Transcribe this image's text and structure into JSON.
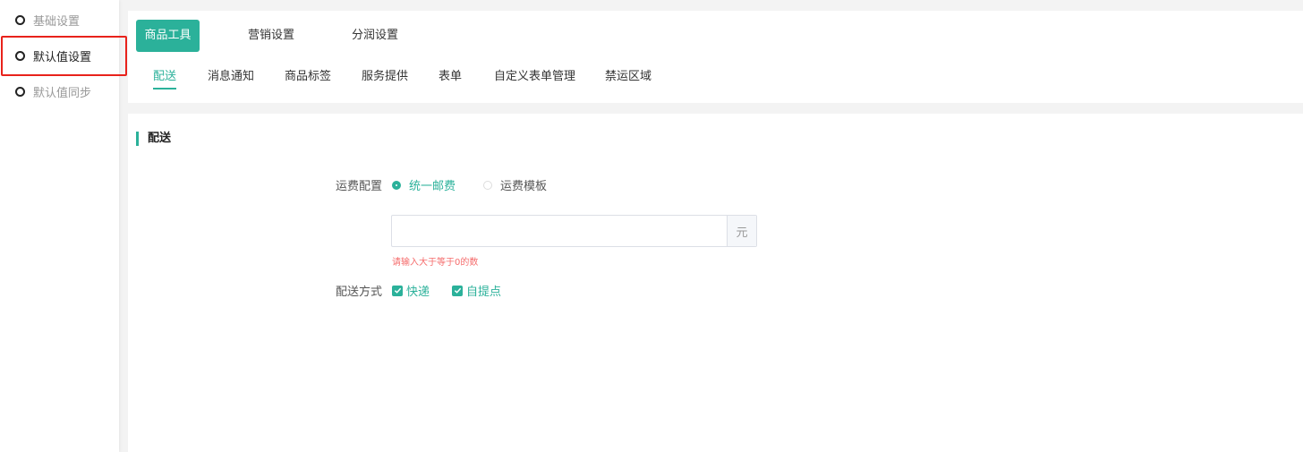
{
  "sidebar": {
    "items": [
      {
        "label": "基础设置"
      },
      {
        "label": "默认值设置"
      },
      {
        "label": "默认值同步"
      }
    ]
  },
  "main_tabs": [
    {
      "label": "商品工具"
    },
    {
      "label": "营销设置"
    },
    {
      "label": "分润设置"
    }
  ],
  "sub_tabs": [
    {
      "label": "配送"
    },
    {
      "label": "消息通知"
    },
    {
      "label": "商品标签"
    },
    {
      "label": "服务提供"
    },
    {
      "label": "表单"
    },
    {
      "label": "自定义表单管理"
    },
    {
      "label": "禁运区域"
    }
  ],
  "section": {
    "title": "配送"
  },
  "form": {
    "freight_label": "运费配置",
    "freight_options": [
      {
        "label": "统一邮费",
        "checked": true
      },
      {
        "label": "运费模板",
        "checked": false
      }
    ],
    "freight_input_value": "",
    "freight_unit": "元",
    "freight_error": "请输入大于等于0的数",
    "delivery_label": "配送方式",
    "delivery_options": [
      {
        "label": "快递",
        "checked": true
      },
      {
        "label": "自提点",
        "checked": true
      }
    ]
  },
  "colors": {
    "accent": "#2bb19a",
    "highlight": "#e8221b",
    "error": "#f56c6c"
  }
}
